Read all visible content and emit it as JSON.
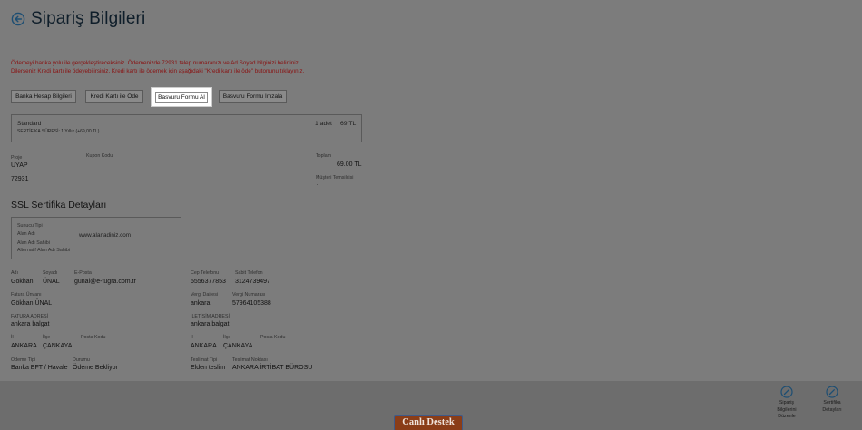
{
  "header": {
    "title": "Sipariş Bilgileri",
    "back_icon": "back-arrow-circle-icon"
  },
  "notice": {
    "line1": "Ödemeyi banka yolu ile gerçekleştireceksiniz. Ödemenizde 72931 talep numaranızı ve Ad Soyad bilginizi belirtiniz.",
    "line2": "Dilerseniz Kredi kartı ile ödeyebilirsiniz. Kredi kartı ile ödemek için aşağıdaki \"Kredi kartı ile öde\" butonunu tıklayınız."
  },
  "actions": {
    "bank": "Banka Hesap Bilgileri",
    "card": "Kredi Kartı ile Öde",
    "form": "Basvuru Formu Al",
    "sign": "Basvuru Formu Imzala"
  },
  "product": {
    "name": "Standard",
    "duration": "SERTİFİKA SÜRESİ: 1 Yıllık (+69,00 TL)",
    "qty": "1 adet",
    "price": "69 TL"
  },
  "order": {
    "proje_label": "Proje",
    "proje_value": "UYAP",
    "kupon_label": "Kupon Kodu",
    "talep_value": "72931",
    "toplam_label": "Toplam",
    "toplam_value": "69.00 TL",
    "temsilci_label": "Müşteri Temsilcisi",
    "temsilci_value": "-"
  },
  "ssl": {
    "title": "SSL Sertifika Detayları",
    "sunucu_tipi": "Sunucu Tipi",
    "alan_adi": "Alan Adı",
    "alan_adi_value": "www.alanadiniz.com",
    "alan_adi_sahibi": "Alan Adı Sahibi",
    "alternatif": "Alternatif Alan Adı Sahibi"
  },
  "contact": {
    "adi_label": "Adı",
    "adi": "Gökhan",
    "soyadi_label": "Soyadı",
    "soyadi": "ÜNAL",
    "eposta_label": "E-Posta",
    "eposta": "gunal@e-tugra.com.tr",
    "cep_label": "Cep Telefonu",
    "cep": "5556377853",
    "sabit_label": "Sabit Telefon",
    "sabit": "3124739497",
    "fatura_unvan_label": "Fatura Ünvanı",
    "fatura_unvan": "Gökhan ÜNAL",
    "vergi_dairesi_label": "Vergi Dairesi",
    "vergi_dairesi": "ankara",
    "vergi_no_label": "Vergi Numarası",
    "vergi_no": "57964105388",
    "fatura_adres_label": "FATURA ADRESİ",
    "fatura_adres": "ankara balgat",
    "iletisim_adres_label": "İLETİŞİM ADRESİ",
    "iletisim_adres": "ankara balgat",
    "il_label": "İl",
    "il": "ANKARA",
    "ilce_label": "İlçe",
    "ilce": "ÇANKAYA",
    "posta_label": "Posta Kodu",
    "il2": "ANKARA",
    "ilce2": "ÇANKAYA",
    "odeme_tipi_label": "Ödeme Tipi",
    "odeme_tipi": "Banka EFT / Havale",
    "durumu_label": "Durumu",
    "durumu": "Ödeme Bekliyor",
    "teslimat_tipi_label": "Teslimat Tipi",
    "teslimat_tipi": "Elden teslim",
    "teslimat_nokta_label": "Teslimat Noktası",
    "teslimat_nokta": "ANKARA İRTİBAT BÜROSU"
  },
  "footer": {
    "edit_order": [
      "Sipariş",
      "Bilgilerini",
      "Düzenle"
    ],
    "cert_details": [
      "Sertifika",
      "Detayları"
    ],
    "edit_icon": "pencil-circle-icon",
    "support": "Canlı Destek"
  },
  "colors": {
    "accent": "#1d4e73",
    "notice": "#8a1010",
    "support": "#8a3d18"
  }
}
